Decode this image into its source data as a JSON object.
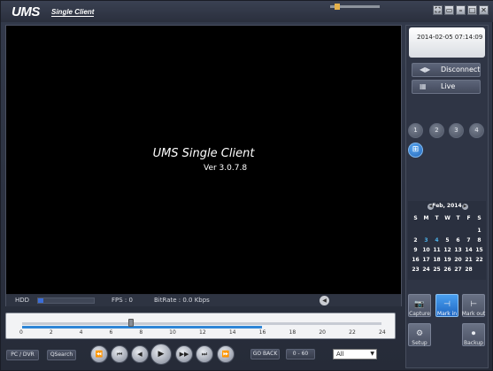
{
  "app": {
    "logo": "UMS",
    "logo_subtitle": "Single Client",
    "window_buttons": [
      "⛶",
      "▭",
      "–",
      "□",
      "✕"
    ]
  },
  "video": {
    "title": "UMS Single Client",
    "version": "Ver 3.0.7.8"
  },
  "status": {
    "hdd_label": "HDD",
    "hdd_fill_fraction": 0.09,
    "fps": "FPS :  0",
    "bitrate": "BitRate : 0.0 Kbps",
    "volume_fraction": 0.1
  },
  "timeline": {
    "ticks": [
      "0",
      "2",
      "4",
      "6",
      "8",
      "10",
      "12",
      "14",
      "16",
      "18",
      "20",
      "22",
      "24"
    ],
    "recorded_until_hour": 16,
    "cursor_hour": 7.3
  },
  "controls": {
    "pc_dvr": "PC / DVR",
    "qsearch": "QSearch",
    "playback_icons": [
      "⏪",
      "⏮",
      "◀",
      "▶",
      "▶▶",
      "⏭",
      "⏩"
    ],
    "go_back": "GO BACK",
    "range": "0 - 60",
    "filter_value": "All"
  },
  "side": {
    "datetime": "2014-02-05 07:14:09",
    "disconnect": "Disconnect",
    "live": "Live",
    "channels": [
      "1",
      "2",
      "3",
      "4"
    ],
    "calendar": {
      "month": "Feb, 2014",
      "days_of_week": [
        "S",
        "M",
        "T",
        "W",
        "T",
        "F",
        "S"
      ],
      "weeks": [
        [
          "",
          "",
          "",
          "",
          "",
          "",
          "1"
        ],
        [
          "2",
          "3",
          "4",
          "5",
          "6",
          "7",
          "8"
        ],
        [
          "9",
          "10",
          "11",
          "12",
          "13",
          "14",
          "15"
        ],
        [
          "16",
          "17",
          "18",
          "19",
          "20",
          "21",
          "22"
        ],
        [
          "23",
          "24",
          "25",
          "26",
          "27",
          "28",
          ""
        ]
      ],
      "recorded_days": [
        "3",
        "4"
      ]
    },
    "capture": "Capture",
    "mark_in": "Mark in",
    "mark_out": "Mark out",
    "setup": "Setup",
    "backup": "Backup"
  },
  "colors": {
    "accent_blue": "#2f86d6",
    "record_day": "#4cb0e8",
    "active_button": "#1f66c2"
  }
}
